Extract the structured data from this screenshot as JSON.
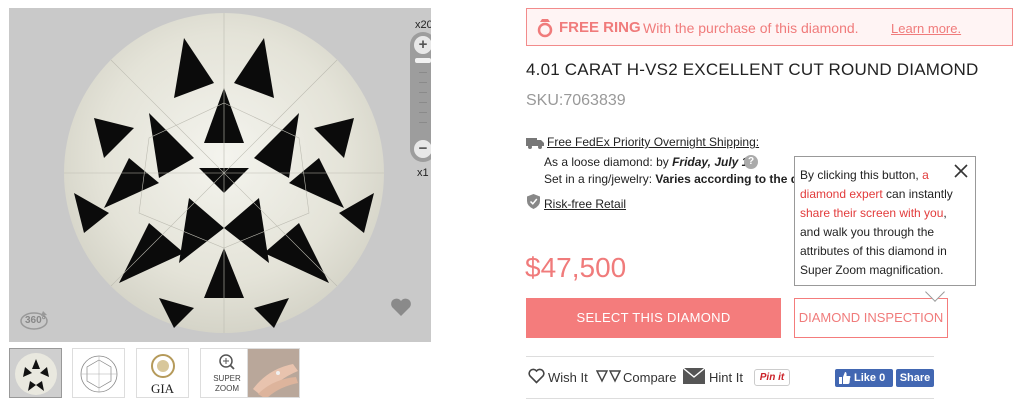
{
  "viewer": {
    "zoom_max_label": "x20",
    "zoom_min_label": "x1",
    "zoom_in_symbol": "+",
    "zoom_out_symbol": "−",
    "rotate_label": "360°",
    "icons": [
      "diamond-image",
      "zoom-plus-icon",
      "zoom-minus-icon",
      "rotate-360-icon",
      "heart-icon"
    ]
  },
  "thumbnails": [
    {
      "name": "diamond-photo",
      "label": ""
    },
    {
      "name": "diamond-diagram",
      "label": ""
    },
    {
      "name": "gia-certificate",
      "label": "GIA"
    },
    {
      "name": "super-zoom",
      "label": "SUPER ZOOM"
    },
    {
      "name": "hand-view",
      "label": ""
    }
  ],
  "promo": {
    "bold": "FREE RING",
    "text": "With the purchase of this diamond.",
    "link": "Learn more."
  },
  "product": {
    "title": "4.01 CARAT H-VS2 EXCELLENT CUT ROUND DIAMOND",
    "sku": "SKU:7063839",
    "price": "$47,500"
  },
  "shipping": {
    "link": "Free FedEx Priority Overnight Shipping:",
    "loose_prefix": "As a loose diamond: by ",
    "loose_date": "Friday, July 19",
    "ring_prefix": "Set in a ring/jewelry: ",
    "ring_value": "Varies according to the diff",
    "risk_link": "Risk-free Retail"
  },
  "tooltip": {
    "p1": "By clicking this button, ",
    "r1": "a diamond expert",
    "p2": " can instantly ",
    "r2": "share their screen with you",
    "p3": ", and walk you through the attributes of this diamond in Super Zoom magnification."
  },
  "buttons": {
    "select": "SELECT THIS DIAMOND",
    "inspect": "DIAMOND INSPECTION"
  },
  "actions": {
    "wish": "Wish It",
    "compare": "Compare",
    "hint": "Hint It",
    "pinit": "Pin it",
    "fb_like": "Like 0",
    "fb_share": "Share"
  },
  "colors": {
    "accent": "#f47c7c",
    "accent_text": "#f07b7b",
    "tooltip_red": "#e23b3b",
    "facebook": "#4267b2"
  }
}
